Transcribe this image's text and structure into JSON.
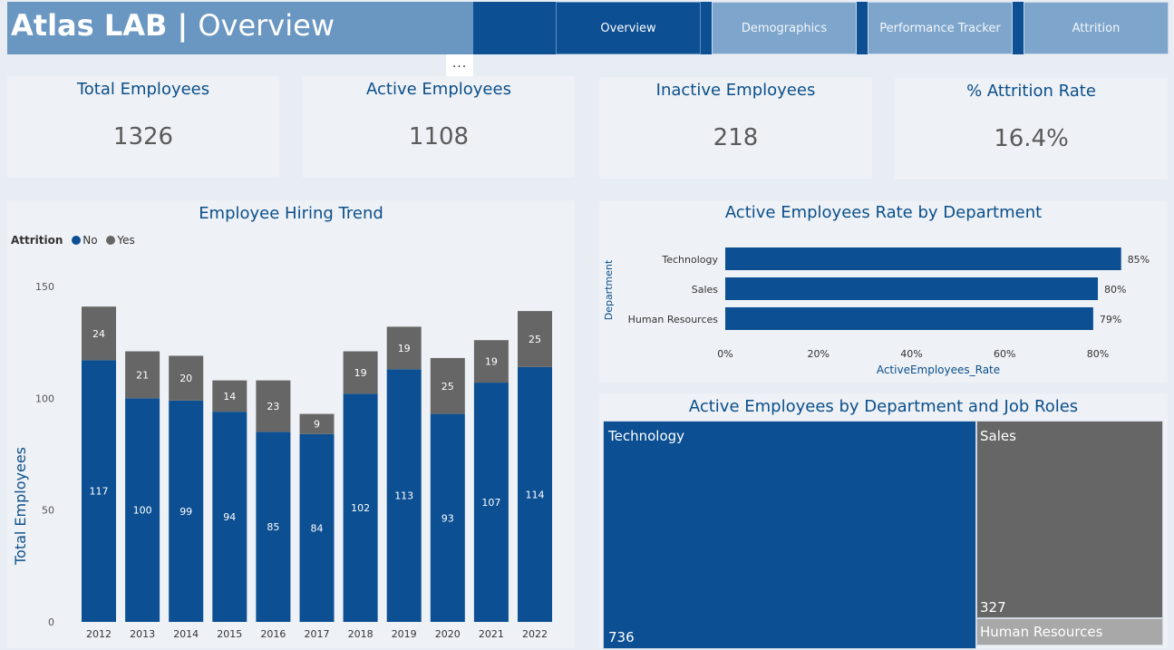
{
  "header": {
    "brand": "Atlas LAB",
    "separator": " | ",
    "page": "Overview",
    "more_icon": "..."
  },
  "tabs": [
    {
      "label": "Overview",
      "active": true
    },
    {
      "label": "Demographics",
      "active": false
    },
    {
      "label": "Performance Tracker",
      "active": false
    },
    {
      "label": "Attrition",
      "active": false
    }
  ],
  "kpis": [
    {
      "title": "Total Employees",
      "value": "1326"
    },
    {
      "title": "Active Employees",
      "value": "1108"
    },
    {
      "title": "Inactive Employees",
      "value": "218"
    },
    {
      "title": "% Attrition Rate",
      "value": "16.4%"
    }
  ],
  "hiring": {
    "title": "Employee Hiring Trend",
    "legend_title": "Attrition",
    "legend_no": "No",
    "legend_yes": "Yes",
    "ylabel": "Total Employees"
  },
  "dept_rate": {
    "title": "Active Employees Rate by Department",
    "ylabel": "Department",
    "xlabel": "ActiveEmployees_Rate"
  },
  "treemap": {
    "title": "Active Employees by Department and Job Roles",
    "items": [
      {
        "name": "Technology",
        "value": "736"
      },
      {
        "name": "Sales",
        "value": "327"
      },
      {
        "name": "Human Resources",
        "value": ""
      }
    ]
  },
  "colors": {
    "no": "#0c4f92",
    "yes": "#666666",
    "hr": "#a8a8a8"
  },
  "chart_data": [
    {
      "type": "bar",
      "stacked": true,
      "categories": [
        "2012",
        "2013",
        "2014",
        "2015",
        "2016",
        "2017",
        "2018",
        "2019",
        "2020",
        "2021",
        "2022"
      ],
      "series": [
        {
          "name": "No",
          "values": [
            117,
            100,
            99,
            94,
            85,
            84,
            102,
            113,
            93,
            107,
            114
          ]
        },
        {
          "name": "Yes",
          "values": [
            24,
            21,
            20,
            14,
            23,
            9,
            19,
            19,
            25,
            19,
            25
          ]
        }
      ],
      "ylim": [
        0,
        150
      ],
      "yticks": [
        0,
        50,
        100,
        150
      ],
      "ylabel": "Total Employees",
      "title": "Employee Hiring Trend"
    },
    {
      "type": "bar",
      "orientation": "horizontal",
      "categories": [
        "Technology",
        "Sales",
        "Human Resources"
      ],
      "values": [
        85,
        80,
        79
      ],
      "value_labels": [
        "85%",
        "80%",
        "79%"
      ],
      "xlim": [
        0,
        80
      ],
      "xticks": [
        "0%",
        "20%",
        "40%",
        "60%",
        "80%"
      ],
      "xlabel": "ActiveEmployees_Rate",
      "ylabel": "Department",
      "title": "Active Employees Rate by Department"
    }
  ]
}
